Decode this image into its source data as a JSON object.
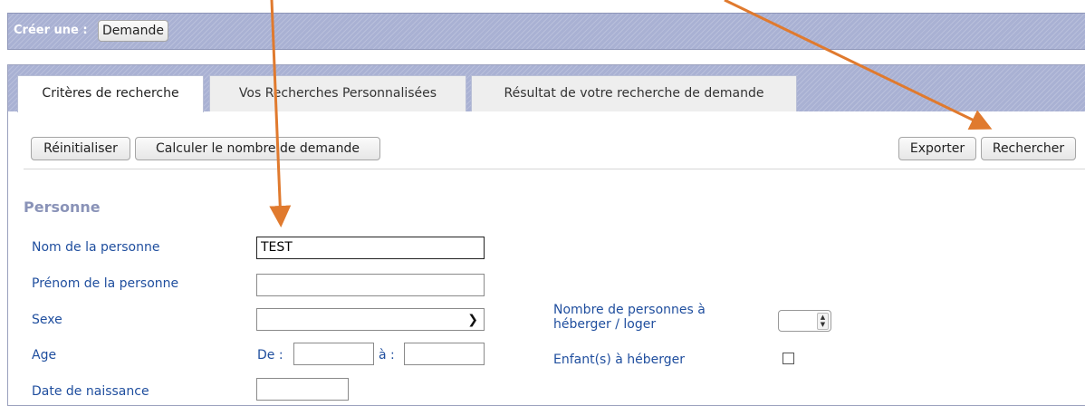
{
  "topbar": {
    "create_label": "Créer une :",
    "demande_button": "Demande"
  },
  "tabs": [
    {
      "label": "Critères de recherche",
      "active": true
    },
    {
      "label": "Vos Recherches Personnalisées",
      "active": false
    },
    {
      "label": "Résultat de votre recherche de demande",
      "active": false
    }
  ],
  "toolbar": {
    "reset": "Réinitialiser",
    "count": "Calculer le nombre de demande",
    "export": "Exporter",
    "search": "Rechercher"
  },
  "section": {
    "title": "Personne"
  },
  "form": {
    "nom_label": "Nom de la personne",
    "nom_value": "TEST",
    "prenom_label": "Prénom de la personne",
    "prenom_value": "",
    "sexe_label": "Sexe",
    "sexe_value": "",
    "age_label": "Age",
    "age_from_label": "De :",
    "age_to_label": "à :",
    "naissance_label": "Date de naissance",
    "nb_personnes_label_1": "Nombre de personnes à",
    "nb_personnes_label_2": "héberger / loger",
    "enfants_label": "Enfant(s) à héberger"
  },
  "colors": {
    "header": "#a9b1d3",
    "label": "#1f4e9e",
    "section": "#8a93b8",
    "annotation_arrow": "#e07a2e"
  }
}
